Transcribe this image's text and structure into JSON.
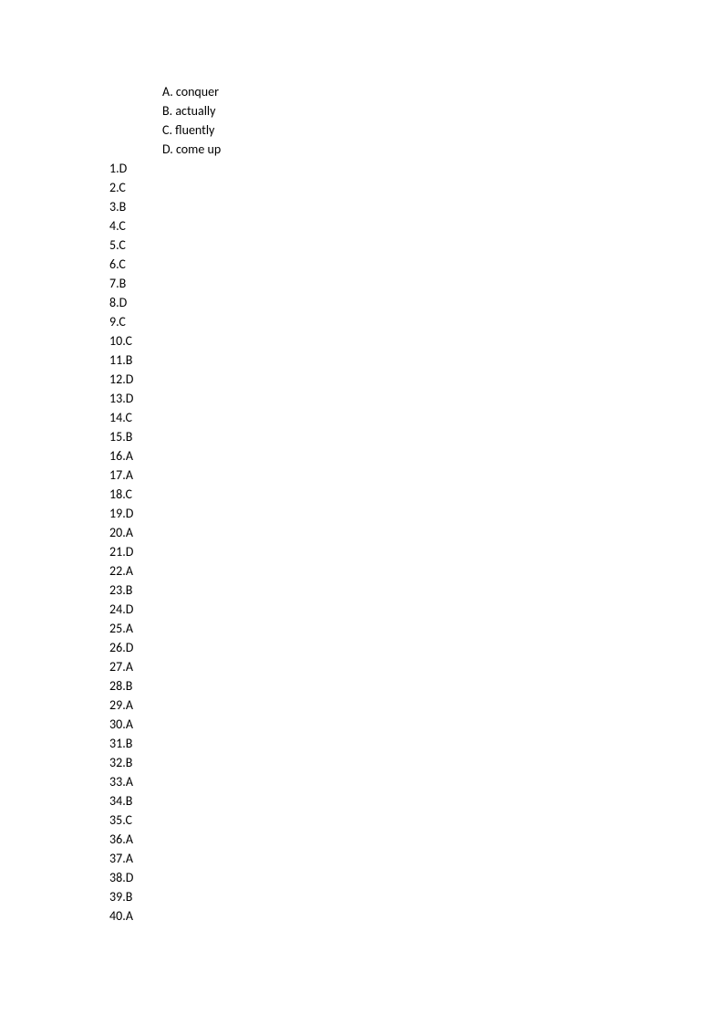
{
  "options": [
    {
      "letter": "A",
      "text": "conquer"
    },
    {
      "letter": "B",
      "text": "actually"
    },
    {
      "letter": "C",
      "text": "fluently"
    },
    {
      "letter": "D",
      "text": "come up"
    }
  ],
  "answers": [
    {
      "num": "1",
      "ans": "D"
    },
    {
      "num": "2",
      "ans": "C"
    },
    {
      "num": "3",
      "ans": "B"
    },
    {
      "num": "4",
      "ans": "C"
    },
    {
      "num": "5",
      "ans": "C"
    },
    {
      "num": "6",
      "ans": "C"
    },
    {
      "num": "7",
      "ans": "B"
    },
    {
      "num": "8",
      "ans": "D"
    },
    {
      "num": "9",
      "ans": "C"
    },
    {
      "num": "10",
      "ans": "C"
    },
    {
      "num": "11",
      "ans": "B"
    },
    {
      "num": "12",
      "ans": "D"
    },
    {
      "num": "13",
      "ans": "D"
    },
    {
      "num": "14",
      "ans": "C"
    },
    {
      "num": "15",
      "ans": "B"
    },
    {
      "num": "16",
      "ans": "A"
    },
    {
      "num": "17",
      "ans": "A"
    },
    {
      "num": "18",
      "ans": "C"
    },
    {
      "num": "19",
      "ans": "D"
    },
    {
      "num": "20",
      "ans": "A"
    },
    {
      "num": "21",
      "ans": "D"
    },
    {
      "num": "22",
      "ans": "A"
    },
    {
      "num": "23",
      "ans": "B"
    },
    {
      "num": "24",
      "ans": "D"
    },
    {
      "num": "25",
      "ans": "A"
    },
    {
      "num": "26",
      "ans": "D"
    },
    {
      "num": "27",
      "ans": "A"
    },
    {
      "num": "28",
      "ans": "B"
    },
    {
      "num": "29",
      "ans": "A"
    },
    {
      "num": "30",
      "ans": "A"
    },
    {
      "num": "31",
      "ans": "B"
    },
    {
      "num": "32",
      "ans": "B"
    },
    {
      "num": "33",
      "ans": "A"
    },
    {
      "num": "34",
      "ans": "B"
    },
    {
      "num": "35",
      "ans": "C"
    },
    {
      "num": "36",
      "ans": "A"
    },
    {
      "num": "37",
      "ans": "A"
    },
    {
      "num": "38",
      "ans": "D"
    },
    {
      "num": "39",
      "ans": "B"
    },
    {
      "num": "40",
      "ans": "A"
    }
  ]
}
